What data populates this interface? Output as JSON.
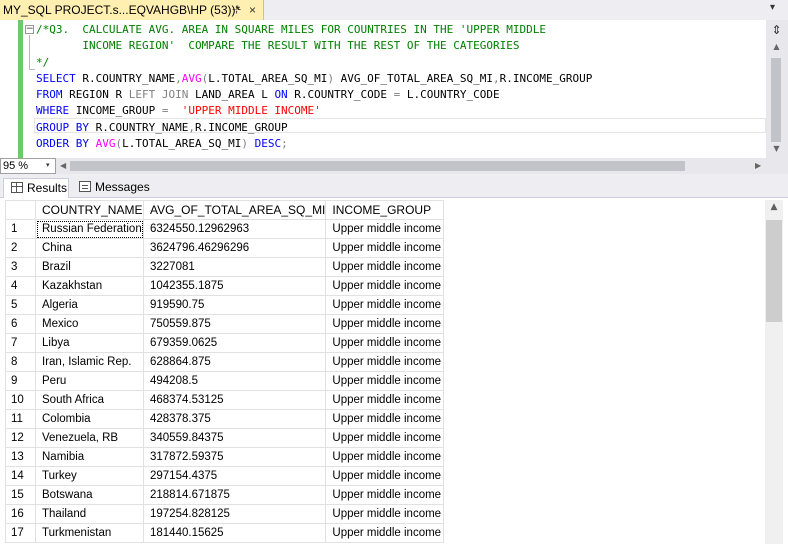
{
  "document_tab": {
    "title": "MY_SQL PROJECT.s...EQVAHGB\\HP (53))*",
    "pin_glyph": "⊹",
    "close_glyph": "×"
  },
  "tab_dropdown_glyph": "▾",
  "editor": {
    "collapse_glyph": "−",
    "split_glyph": "⇕",
    "lines": [
      [
        {
          "c": "c",
          "t": "/*Q3.  CALCULATE AVG. AREA IN SQUARE MILES FOR COUNTRIES IN THE 'UPPER MIDDLE"
        }
      ],
      [
        {
          "c": "c",
          "t": "       INCOME REGION'  COMPARE THE RESULT WITH THE REST OF THE CATEGORIES"
        }
      ],
      [
        {
          "c": "c",
          "t": "*/"
        }
      ],
      [
        {
          "c": "k",
          "t": "SELECT"
        },
        {
          "c": "t",
          "t": " R.COUNTRY_NAME"
        },
        {
          "c": "g",
          "t": ","
        },
        {
          "c": "f",
          "t": "AVG"
        },
        {
          "c": "g",
          "t": "("
        },
        {
          "c": "t",
          "t": "L.TOTAL_AREA_SQ_MI"
        },
        {
          "c": "g",
          "t": ")"
        },
        {
          "c": "t",
          "t": " AVG_OF_TOTAL_AREA_SQ_MI"
        },
        {
          "c": "g",
          "t": ","
        },
        {
          "c": "t",
          "t": "R.INCOME_GROUP"
        }
      ],
      [
        {
          "c": "k",
          "t": "FROM"
        },
        {
          "c": "t",
          "t": " REGION R "
        },
        {
          "c": "g",
          "t": "LEFT JOIN"
        },
        {
          "c": "t",
          "t": " LAND_AREA L "
        },
        {
          "c": "k",
          "t": "ON"
        },
        {
          "c": "t",
          "t": " R.COUNTRY_CODE "
        },
        {
          "c": "g",
          "t": "="
        },
        {
          "c": "t",
          "t": " L.COUNTRY_CODE"
        }
      ],
      [
        {
          "c": "k",
          "t": "WHERE"
        },
        {
          "c": "t",
          "t": " INCOME_GROUP "
        },
        {
          "c": "g",
          "t": "="
        },
        {
          "c": "t",
          "t": "  "
        },
        {
          "c": "s",
          "t": "'UPPER MIDDLE INCOME'"
        }
      ],
      [
        {
          "c": "k",
          "t": "GROUP BY"
        },
        {
          "c": "t",
          "t": " R.COUNTRY_NAME"
        },
        {
          "c": "g",
          "t": ","
        },
        {
          "c": "t",
          "t": "R.INCOME_GROUP"
        }
      ],
      [
        {
          "c": "k",
          "t": "ORDER BY"
        },
        {
          "c": "t",
          "t": " "
        },
        {
          "c": "f",
          "t": "AVG"
        },
        {
          "c": "g",
          "t": "("
        },
        {
          "c": "t",
          "t": "L.TOTAL_AREA_SQ_MI"
        },
        {
          "c": "g",
          "t": ")"
        },
        {
          "c": "t",
          "t": " "
        },
        {
          "c": "k",
          "t": "DESC"
        },
        {
          "c": "g",
          "t": ";"
        }
      ]
    ],
    "syntax_colors": {
      "comment": "#008000",
      "keyword": "#0000ff",
      "function": "#ff00ff",
      "operator": "#808080",
      "string": "#ff0000"
    },
    "change_bar_color": "#6dc96d"
  },
  "zoom": {
    "value": "95 %",
    "arrow": "▾"
  },
  "scroll_glyphs": {
    "up": "▲",
    "down": "▼",
    "left": "◀",
    "right": "▶"
  },
  "results_tabs": [
    {
      "label": "Results",
      "active": true
    },
    {
      "label": "Messages",
      "active": false
    }
  ],
  "grid": {
    "columns": [
      "COUNTRY_NAME",
      "AVG_OF_TOTAL_AREA_SQ_MI",
      "INCOME_GROUP"
    ],
    "rows": [
      [
        "1",
        "Russian Federation",
        "6324550.12962963",
        "Upper middle income"
      ],
      [
        "2",
        "China",
        "3624796.46296296",
        "Upper middle income"
      ],
      [
        "3",
        "Brazil",
        "3227081",
        "Upper middle income"
      ],
      [
        "4",
        "Kazakhstan",
        "1042355.1875",
        "Upper middle income"
      ],
      [
        "5",
        "Algeria",
        "919590.75",
        "Upper middle income"
      ],
      [
        "6",
        "Mexico",
        "750559.875",
        "Upper middle income"
      ],
      [
        "7",
        "Libya",
        "679359.0625",
        "Upper middle income"
      ],
      [
        "8",
        "Iran, Islamic Rep.",
        "628864.875",
        "Upper middle income"
      ],
      [
        "9",
        "Peru",
        "494208.5",
        "Upper middle income"
      ],
      [
        "10",
        "South Africa",
        "468374.53125",
        "Upper middle income"
      ],
      [
        "11",
        "Colombia",
        "428378.375",
        "Upper middle income"
      ],
      [
        "12",
        "Venezuela, RB",
        "340559.84375",
        "Upper middle income"
      ],
      [
        "13",
        "Namibia",
        "317872.59375",
        "Upper middle income"
      ],
      [
        "14",
        "Turkey",
        "297154.4375",
        "Upper middle income"
      ],
      [
        "15",
        "Botswana",
        "218814.671875",
        "Upper middle income"
      ],
      [
        "16",
        "Thailand",
        "197254.828125",
        "Upper middle income"
      ],
      [
        "17",
        "Turkmenistan",
        "181440.15625",
        "Upper middle income"
      ]
    ]
  }
}
